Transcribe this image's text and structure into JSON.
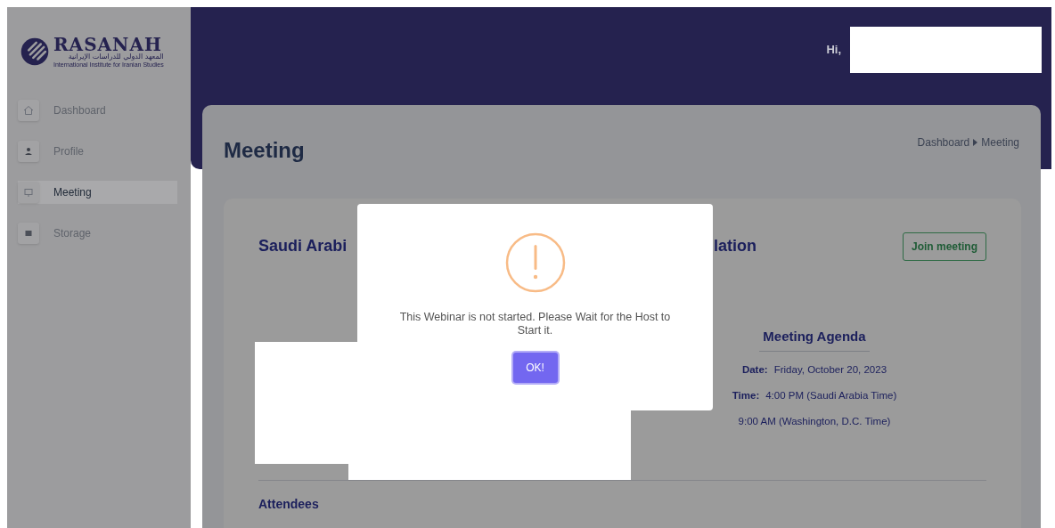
{
  "brand": {
    "name": "RASANAH",
    "arabic_name": "المعهد الدولي للدراسات الإيرانية",
    "subtitle": "International Institute for Iranian Studies"
  },
  "sidebar": {
    "items": [
      {
        "label": "Dashboard",
        "selected": false
      },
      {
        "label": "Profile",
        "selected": false
      },
      {
        "label": "Meeting",
        "selected": true
      },
      {
        "label": "Storage",
        "selected": false
      }
    ]
  },
  "header": {
    "greeting": "Hi,"
  },
  "page": {
    "title": "Meeting",
    "breadcrumb": [
      "Dashboard",
      "Meeting"
    ]
  },
  "meeting": {
    "title_parts": [
      "Saudi Arabi",
      "lation"
    ],
    "join_button": "Join meeting",
    "agenda": {
      "heading": "Meeting Agenda",
      "rows": [
        {
          "label": "Date:",
          "value": "Friday, October 20, 2023"
        },
        {
          "label": "Time:",
          "value": "4:00 PM (Saudi Arabia Time)"
        },
        {
          "value": "9:00 AM (Washington, D.C. Time)"
        }
      ]
    },
    "attendees_heading": "Attendees"
  },
  "dialog": {
    "message": "This Webinar is not started. Please Wait for the Host to Start it.",
    "button": "OK!"
  }
}
